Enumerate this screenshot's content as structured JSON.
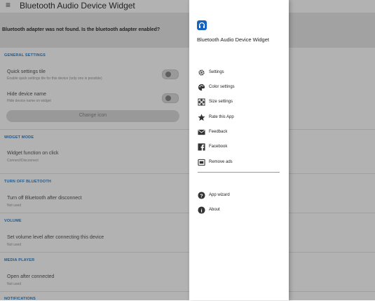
{
  "app": {
    "title": "Bluetooth Audio Device Widget",
    "banner": "Bluetooth adapter was not found. Is the bluetooth adapter enabled?"
  },
  "sections": {
    "general": "GENERAL SETTINGS",
    "widget_mode": "WIDGET MODE",
    "turn_off": "TURN OFF BLUETOOTH",
    "volume": "VOLUME",
    "media_player": "MEDIA PLAYER",
    "notifications": "NOTIFICATIONS"
  },
  "items": {
    "quick_tile_title": "Quick settings tile",
    "quick_tile_sub": "Enable quick settings tile for this device (only one is possible)",
    "hide_name_title": "Hide device name",
    "hide_name_sub": "Hide device name on widget",
    "change_icon": "Change icon",
    "widget_fn_title": "Widget function on click",
    "widget_fn_sub": "Connect/Disconnect",
    "turn_off_title": "Turn off Bluetooth after disconnect",
    "turn_off_sub": "Not used",
    "volume_title": "Set volume level after connecting this device",
    "volume_sub": "Not used",
    "open_title": "Open after connected",
    "open_sub": "Not used"
  },
  "drawer": {
    "title": "Bluetooth Audio Device Widget",
    "items": [
      {
        "label": "Settings",
        "icon": "gear-icon"
      },
      {
        "label": "Color settings",
        "icon": "palette-icon"
      },
      {
        "label": "Size settings",
        "icon": "resize-icon"
      },
      {
        "label": "Rate this App",
        "icon": "star-icon"
      },
      {
        "label": "Feedback",
        "icon": "mail-icon"
      },
      {
        "label": "Facebook",
        "icon": "facebook-icon"
      },
      {
        "label": "Remove ads",
        "icon": "ad-icon"
      },
      {
        "label": "App wizard",
        "icon": "help-icon"
      },
      {
        "label": "About",
        "icon": "info-icon"
      }
    ]
  },
  "colors": {
    "accent": "#2f80c8",
    "icon_bg": "#1565c0"
  }
}
